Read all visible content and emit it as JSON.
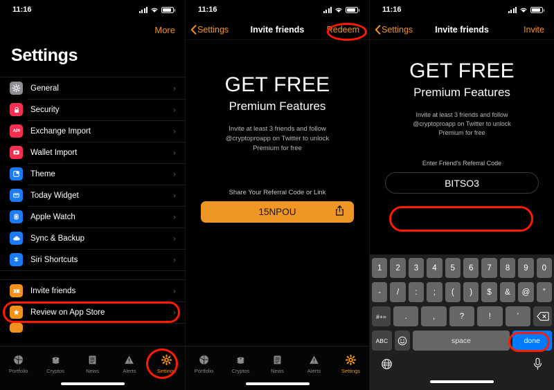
{
  "status_bar": {
    "time": "11:16",
    "signal_icon": "cellular-bars-icon",
    "wifi_icon": "wifi-icon",
    "battery_icon": "battery-icon"
  },
  "panel1": {
    "more_label": "More",
    "title": "Settings",
    "groups": [
      {
        "items": [
          {
            "label": "General",
            "icon": "gear-icon",
            "icon_color": "#8E8E93",
            "glyph": "⚙"
          },
          {
            "label": "Security",
            "icon": "lock-icon",
            "icon_color": "#F5304F",
            "glyph": "🔒"
          },
          {
            "label": "Exchange Import",
            "icon": "api-icon",
            "icon_color": "#F5304F",
            "glyph": "API"
          },
          {
            "label": "Wallet Import",
            "icon": "wallet-icon",
            "icon_color": "#F5304F",
            "glyph": "▭"
          },
          {
            "label": "Theme",
            "icon": "theme-icon",
            "icon_color": "#1A7BF5",
            "glyph": "◱"
          },
          {
            "label": "Today Widget",
            "icon": "widget-icon",
            "icon_color": "#1A7BF5",
            "glyph": "▭"
          },
          {
            "label": "Apple Watch",
            "icon": "apple-watch-icon",
            "icon_color": "#1A7BF5",
            "glyph": "⌚"
          },
          {
            "label": "Sync & Backup",
            "icon": "cloud-icon",
            "icon_color": "#1A7BF5",
            "glyph": "☁"
          },
          {
            "label": "Siri Shortcuts",
            "icon": "siri-shortcuts-icon",
            "icon_color": "#1A7BF5",
            "glyph": "S"
          }
        ]
      },
      {
        "items": [
          {
            "label": "Invite friends",
            "icon": "ticket-icon",
            "icon_color": "#F2921D",
            "glyph": "🎟",
            "highlighted": true
          },
          {
            "label": "Review on App Store",
            "icon": "star-icon",
            "icon_color": "#F2921D",
            "glyph": "★"
          }
        ]
      }
    ],
    "chevron": "›"
  },
  "tabbar": {
    "items": [
      {
        "label": "Portfolio",
        "icon": "pie-chart-icon",
        "active": false
      },
      {
        "label": "Cryptos",
        "icon": "coins-stack-icon",
        "active": false
      },
      {
        "label": "News",
        "icon": "document-lines-icon",
        "active": false
      },
      {
        "label": "Alerts",
        "icon": "warning-triangle-icon",
        "active": false
      },
      {
        "label": "Settings",
        "icon": "gear-icon",
        "active": true
      }
    ]
  },
  "panel2": {
    "nav": {
      "back_label": "Settings",
      "title": "Invite friends",
      "right_label": "Redeem"
    },
    "promo": {
      "headline": "GET FREE",
      "subhead": "Premium Features",
      "body": "Invite at least 3 friends and follow @cryptoproapp on Twitter to unlock Premium for free"
    },
    "share_label": "Share Your Referral Code or Link",
    "referral_code": "15NPOU",
    "share_icon": "share-upload-icon"
  },
  "panel3": {
    "nav": {
      "back_label": "Settings",
      "title": "Invite friends",
      "right_label": "Invite"
    },
    "promo": {
      "headline": "GET FREE",
      "subhead": "Premium Features",
      "body": "Invite at least 3 friends and follow @cryptoproapp on Twitter to unlock Premium for free"
    },
    "enter_label": "Enter Friend's Referral Code",
    "entered_code": "BITSO3",
    "keyboard": {
      "row1": [
        "1",
        "2",
        "3",
        "4",
        "5",
        "6",
        "7",
        "8",
        "9",
        "0"
      ],
      "row2": [
        "-",
        "/",
        ":",
        ";",
        "(",
        ")",
        "$",
        "&",
        "@",
        "”"
      ],
      "row3": [
        "#+=",
        ".",
        ",",
        "?",
        "!",
        "’"
      ],
      "backspace_icon": "backspace-icon",
      "abc_label": "ABC",
      "emoji_icon": "emoji-smiley-icon",
      "space_label": "space",
      "done_label": "done",
      "globe_icon": "globe-icon",
      "mic_icon": "microphone-icon"
    }
  },
  "annotations": {
    "color": "#FF1A00",
    "marks": [
      "invite-friends-row",
      "settings-tab",
      "redeem-button",
      "referral-code-field",
      "done-key"
    ]
  }
}
